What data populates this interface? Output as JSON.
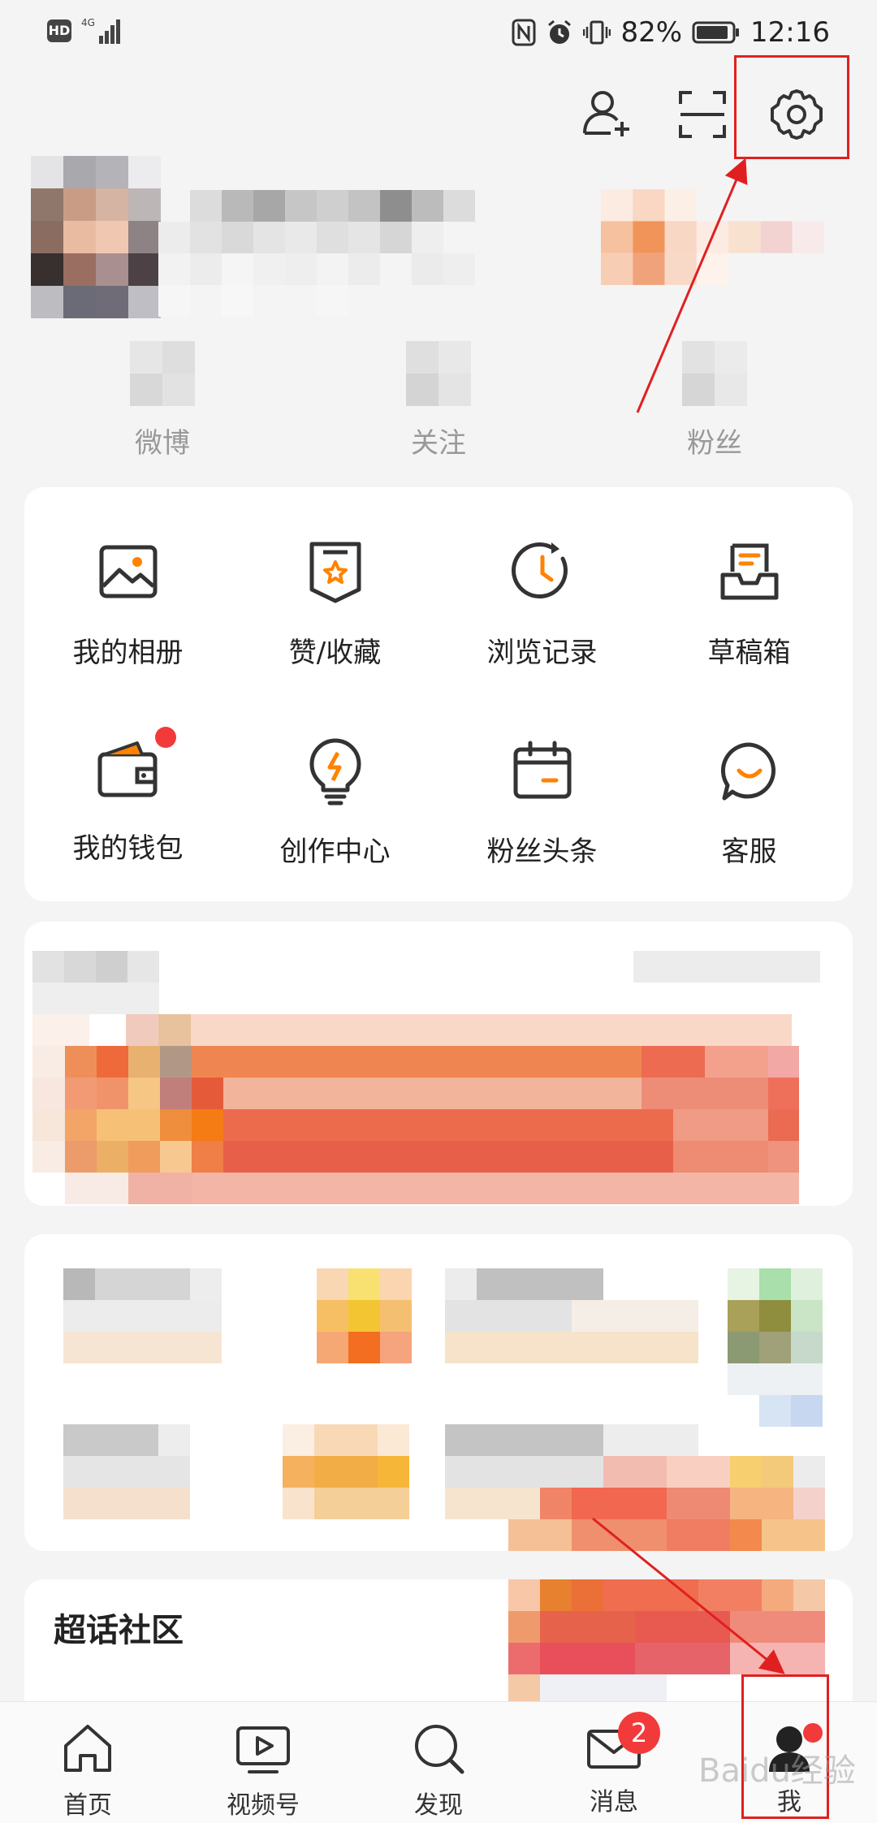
{
  "status_bar": {
    "hd": "HD",
    "battery_percent": "82%",
    "time": "12:16"
  },
  "header": {
    "icons": [
      "add-friend-icon",
      "scan-icon",
      "settings-icon"
    ]
  },
  "profile": {
    "stats": [
      {
        "label": "微博"
      },
      {
        "label": "关注"
      },
      {
        "label": "粉丝"
      }
    ]
  },
  "tools": [
    {
      "label": "我的相册",
      "icon": "album-icon"
    },
    {
      "label": "赞/收藏",
      "icon": "favorite-icon"
    },
    {
      "label": "浏览记录",
      "icon": "history-icon"
    },
    {
      "label": "草稿箱",
      "icon": "drafts-icon"
    },
    {
      "label": "我的钱包",
      "icon": "wallet-icon"
    },
    {
      "label": "创作中心",
      "icon": "creator-icon"
    },
    {
      "label": "粉丝头条",
      "icon": "fan-headline-icon"
    },
    {
      "label": "客服",
      "icon": "customer-service-icon"
    }
  ],
  "community": {
    "title": "超话社区"
  },
  "tabbar": {
    "items": [
      {
        "label": "首页",
        "icon": "home-icon"
      },
      {
        "label": "视频号",
        "icon": "video-icon"
      },
      {
        "label": "发现",
        "icon": "discover-icon"
      },
      {
        "label": "消息",
        "icon": "message-icon",
        "badge": "2"
      },
      {
        "label": "我",
        "icon": "me-icon"
      }
    ]
  },
  "watermark": "Baidu经验",
  "colors": {
    "accent": "#ff8200",
    "badge": "#f23a3a",
    "annotation": "#e02020"
  }
}
